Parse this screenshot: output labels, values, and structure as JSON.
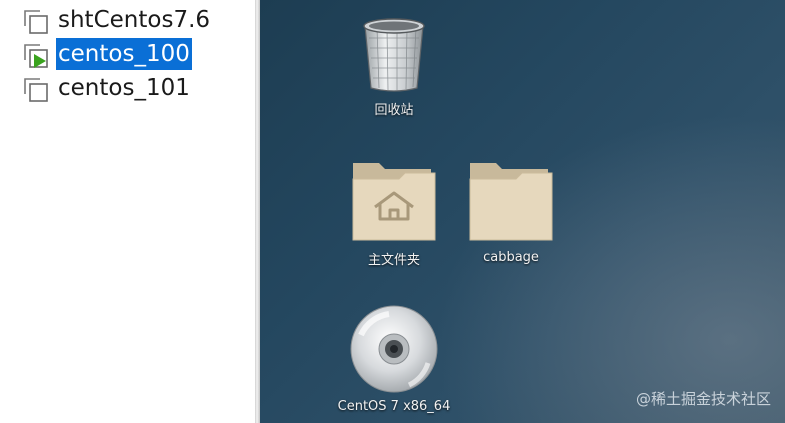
{
  "vm_library": {
    "items": [
      {
        "name": "shtCentos7.6",
        "running": false,
        "selected": false
      },
      {
        "name": "centos_100",
        "running": true,
        "selected": true
      },
      {
        "name": "centos_101",
        "running": false,
        "selected": false
      }
    ]
  },
  "desktop": {
    "icons": {
      "trash": {
        "label": "回收站",
        "icon": "trash-icon"
      },
      "home": {
        "label": "主文件夹",
        "icon": "home-folder-icon"
      },
      "cabbage": {
        "label": "cabbage",
        "icon": "folder-icon"
      },
      "disc": {
        "label": "CentOS 7 x86_64",
        "icon": "optical-disc-icon"
      }
    }
  },
  "watermark": "@稀土掘金技术社区",
  "colors": {
    "selection": "#0a6fd6",
    "running_indicator": "#3aa31e",
    "desktop_bg": "#24475f"
  }
}
